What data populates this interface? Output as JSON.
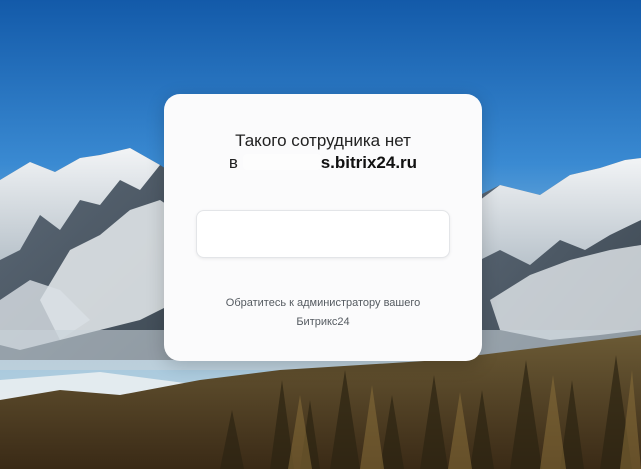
{
  "dialog": {
    "title": "Такого сотрудника нет",
    "subtitle_prefix": "в",
    "portal_domain": "s.bitrix24.ru",
    "input_value": "",
    "hint": "Обратитесь к администратору вашего Битрикс24"
  },
  "colors": {
    "dialog_background": "#fbfbfc",
    "title_text": "#222222",
    "hint_text": "#555b61",
    "sky_top": "#1e63b3"
  },
  "background": {
    "scene": "mountain-landscape"
  }
}
